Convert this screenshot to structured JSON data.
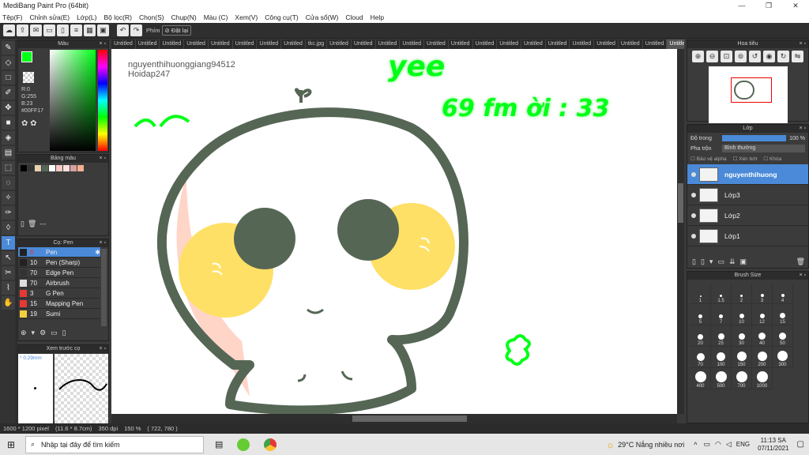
{
  "window": {
    "title": "MediBang Paint Pro (64bit)"
  },
  "menu": [
    "Tệp(F)",
    "Chỉnh sửa(E)",
    "Lớp(L)",
    "Bộ lọc(R)",
    "Chọn(S)",
    "Chụp(N)",
    "Màu (C)",
    "Xem(V)",
    "Công cụ(T)",
    "Cửa sổ(W)",
    "Cloud",
    "Help"
  ],
  "toolbar": {
    "label_phim": "Phím",
    "reset_label": "Đặt lại"
  },
  "panels": {
    "color": {
      "title": "Màu",
      "r": "R:0",
      "g": "G:255",
      "b": "B:23",
      "hex": "#00FF17"
    },
    "palette": {
      "title": "Bảng màu",
      "placeholder": "---"
    },
    "brush": {
      "title": "Cọ: Pen",
      "items": [
        {
          "size": "8",
          "name": "Pen",
          "color": "#222222"
        },
        {
          "size": "10",
          "name": "Pen (Sharp)",
          "color": "#222222"
        },
        {
          "size": "70",
          "name": "Edge Pen",
          "color": "#333333"
        },
        {
          "size": "70",
          "name": "Airbrush",
          "color": "#dddddd"
        },
        {
          "size": "3",
          "name": "G Pen",
          "color": "#e53935"
        },
        {
          "size": "15",
          "name": "Mapping Pen",
          "color": "#e53935"
        },
        {
          "size": "19",
          "name": "Sumi",
          "color": "#f4d03f"
        }
      ]
    },
    "preview": {
      "title": "Xem trước cọ",
      "size": "* 0.29mm"
    },
    "navigator": {
      "title": "Hoa tiêu"
    },
    "layer": {
      "title": "Lớp",
      "opacity_label": "Độ trong",
      "opacity_value": "100 %",
      "blend_label": "Pha trộn",
      "blend_value": "Bình thường",
      "protect_alpha": "Bảo vệ alpha",
      "clipping": "Xén bớt",
      "lock": "Khóa",
      "layers": [
        {
          "name": "nguyenthihuong",
          "selected": true
        },
        {
          "name": "Lớp3",
          "selected": false
        },
        {
          "name": "Lớp2",
          "selected": false
        },
        {
          "name": "Lớp1",
          "selected": false
        }
      ]
    },
    "brushsize": {
      "title": "Brush Size",
      "sizes": [
        "1",
        "1.5",
        "2",
        "3",
        "4",
        "5",
        "7",
        "10",
        "12",
        "15",
        "20",
        "25",
        "30",
        "40",
        "50",
        "70",
        "100",
        "150",
        "200",
        "300",
        "400",
        "500",
        "700",
        "1000"
      ]
    }
  },
  "tabs": [
    "Untitled",
    "Untitled",
    "Untitled",
    "Untitled",
    "Untitled",
    "Untitled",
    "Untitled",
    "Untitled",
    "tkc.jpg",
    "Untitled",
    "Untitled",
    "Untitled",
    "Untitled",
    "Untitled",
    "Untitled",
    "Untitled",
    "Untitled",
    "Untitled",
    "Untitled",
    "Untitled",
    "Untitled",
    "Untitled",
    "Untitled",
    "Untitled"
  ],
  "canvas": {
    "user": "nguyenthihuonggiang94512",
    "site": "Hoidap247",
    "yee": "yee",
    "line2": "69 fm ời : 33"
  },
  "status": {
    "size": "1600 * 1200 pixel",
    "cm": "(11.6 * 8.7cm)",
    "dpi": "350 dpi",
    "zoom": "150 %",
    "coords": "( 722, 780 )"
  },
  "taskbar": {
    "search": "Nhập tại đây để tìm kiếm",
    "weather": "29°C  Nắng nhiều nơi",
    "lang": "ENG",
    "time": "11:13 SA",
    "date": "07/11/2021"
  },
  "colors": {
    "accent": "#4a8ad8",
    "green": "#00ff17",
    "outline": "#556655",
    "yellow": "#ffe066",
    "pink": "#ffd5c8"
  }
}
